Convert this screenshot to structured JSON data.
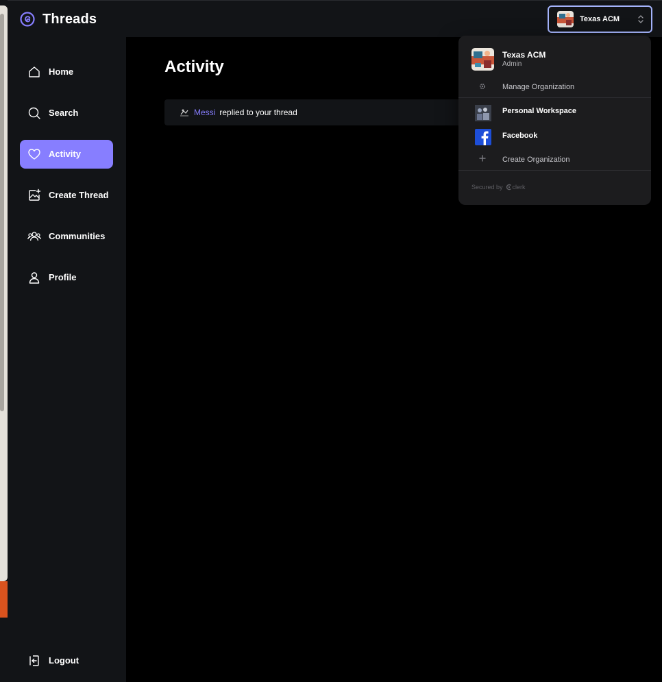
{
  "app": {
    "brand": "Threads"
  },
  "topbar": {
    "org_switcher": {
      "name": "Texas ACM"
    }
  },
  "sidebar": {
    "items": [
      {
        "label": "Home",
        "icon": "home-icon",
        "active": false
      },
      {
        "label": "Search",
        "icon": "search-icon",
        "active": false
      },
      {
        "label": "Activity",
        "icon": "heart-icon",
        "active": true
      },
      {
        "label": "Create Thread",
        "icon": "create-thread-icon",
        "active": false
      },
      {
        "label": "Communities",
        "icon": "communities-icon",
        "active": false
      },
      {
        "label": "Profile",
        "icon": "user-icon",
        "active": false
      }
    ],
    "logout": {
      "label": "Logout",
      "icon": "logout-icon"
    }
  },
  "main": {
    "title": "Activity",
    "activities": [
      {
        "user": "Messi",
        "message": "replied to your thread"
      }
    ]
  },
  "dropdown": {
    "current": {
      "name": "Texas ACM",
      "role": "Admin"
    },
    "manage_label": "Manage Organization",
    "workspaces": [
      {
        "name": "Personal Workspace",
        "icon": "personal-workspace-avatar"
      },
      {
        "name": "Facebook",
        "icon": "facebook-icon"
      }
    ],
    "create_label": "Create Organization",
    "secured_by": "Secured by",
    "clerk_label": "clerk"
  },
  "colors": {
    "accent": "#877eff",
    "panel": "#121417",
    "background": "#000000",
    "focus_ring": "#a5b4fc"
  }
}
